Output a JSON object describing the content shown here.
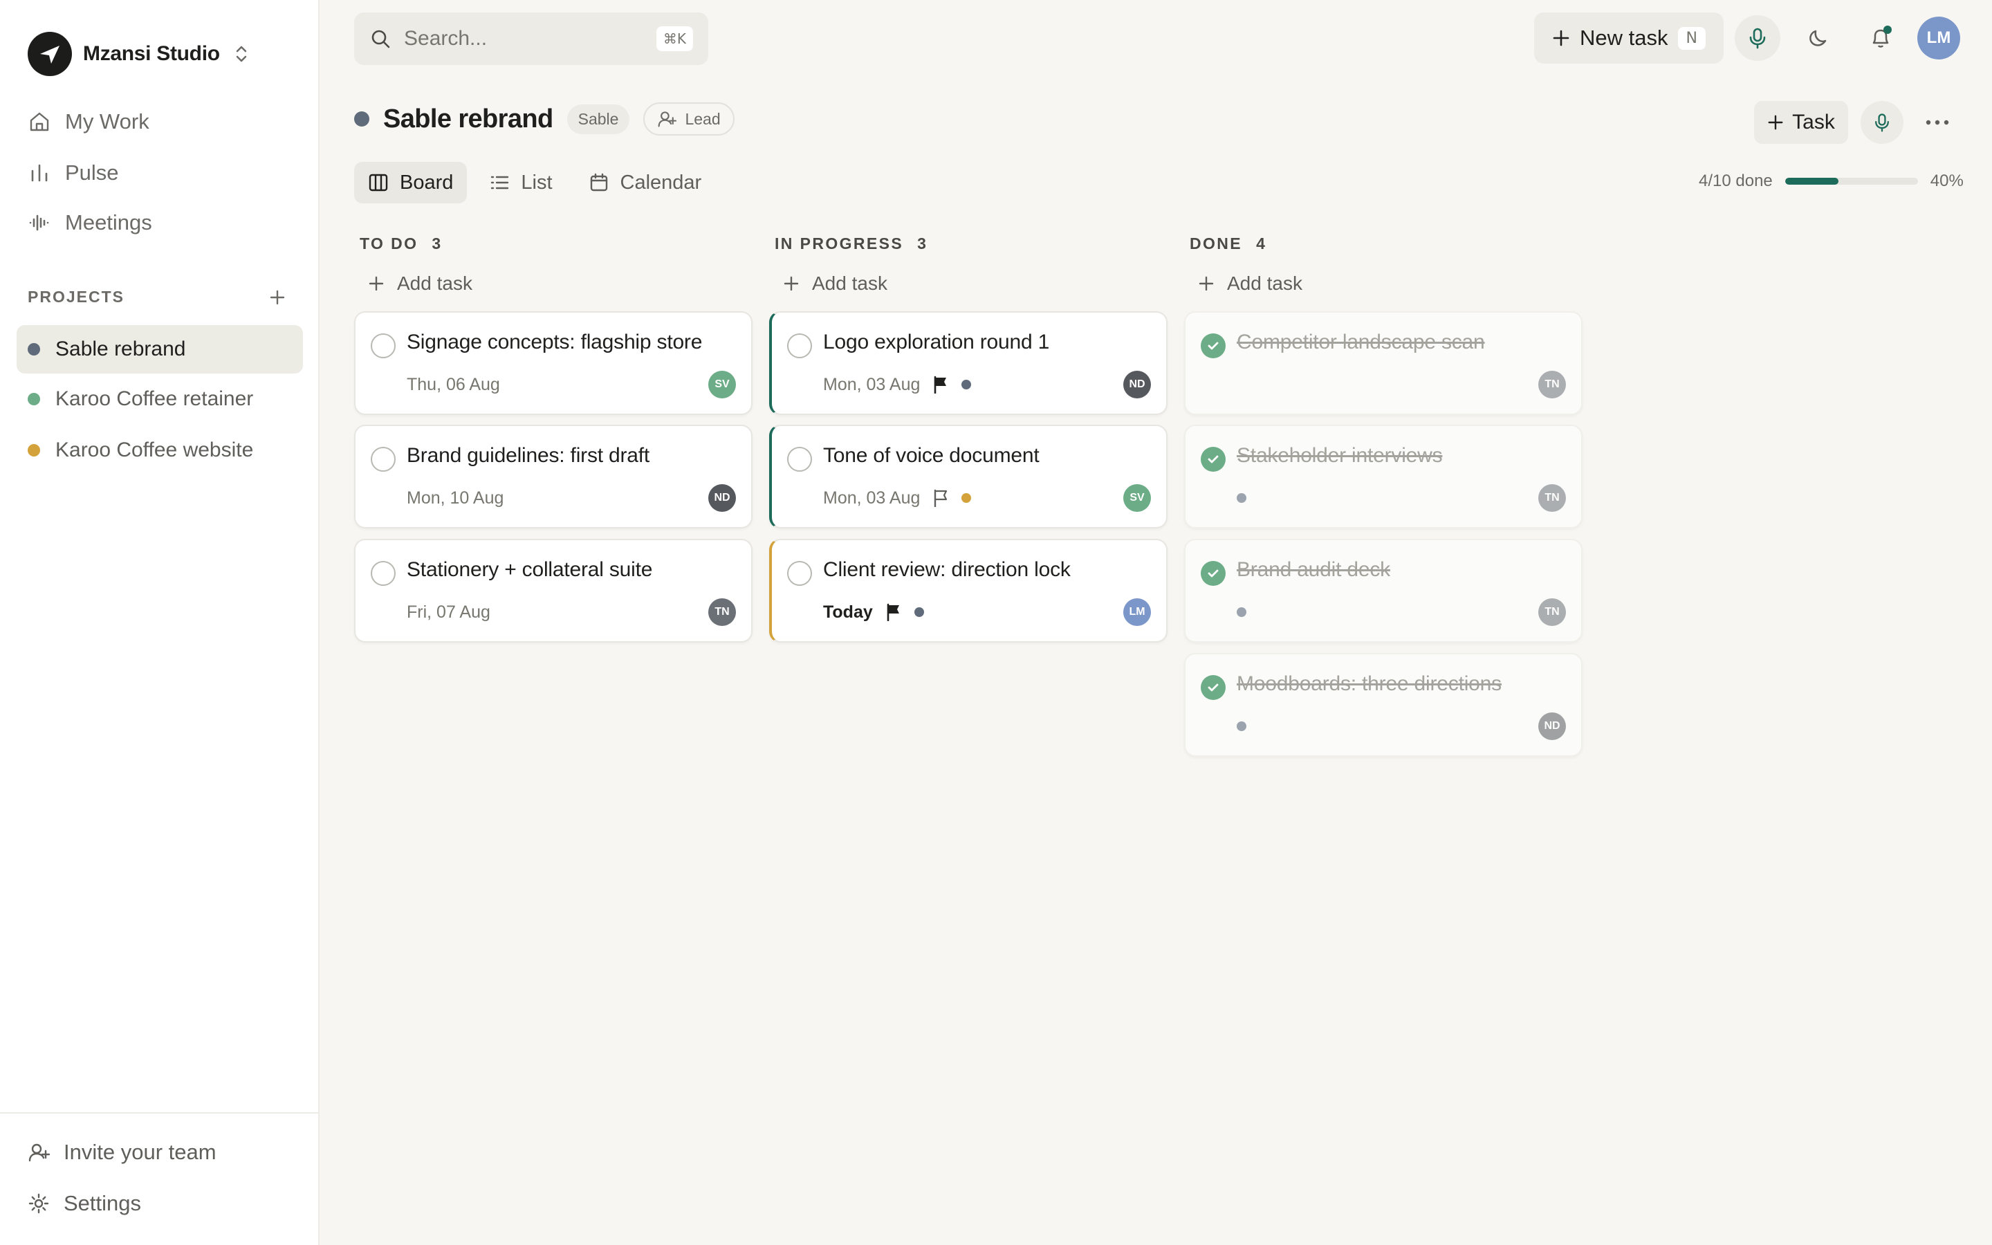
{
  "workspace": {
    "name": "Mzansi Studio"
  },
  "nav": {
    "my_work": "My Work",
    "pulse": "Pulse",
    "meetings": "Meetings"
  },
  "projects": {
    "title": "PROJECTS",
    "items": [
      {
        "label": "Sable rebrand",
        "color": "#5f6b7a",
        "active": true
      },
      {
        "label": "Karoo Coffee retainer",
        "color": "#6cad87",
        "active": false
      },
      {
        "label": "Karoo Coffee website",
        "color": "#d3a23a",
        "active": false
      }
    ]
  },
  "sidebar_bottom": {
    "invite": "Invite your team",
    "settings": "Settings"
  },
  "search": {
    "placeholder": "Search...",
    "shortcut": "⌘K"
  },
  "topbar": {
    "new_task": "New task",
    "new_task_shortcut": "N",
    "user_initials": "LM"
  },
  "project": {
    "title": "Sable rebrand",
    "tag": "Sable",
    "lead": "Lead",
    "task_button": "Task",
    "views": [
      "Board",
      "List",
      "Calendar"
    ],
    "active_view": "Board",
    "progress_label": "4/10 done",
    "progress_percent": "40%",
    "progress_value": 0.4
  },
  "board": {
    "add_task": "Add task",
    "columns": [
      {
        "title": "TO DO",
        "count": "3",
        "cards": [
          {
            "title": "Signage concepts: flagship store",
            "date": "Thu, 06 Aug",
            "assignee": "SV"
          },
          {
            "title": "Brand guidelines: first draft",
            "date": "Mon, 10 Aug",
            "assignee": "ND"
          },
          {
            "title": "Stationery + collateral suite",
            "date": "Fri, 07 Aug",
            "assignee": "TN"
          }
        ]
      },
      {
        "title": "IN PROGRESS",
        "count": "3",
        "cards": [
          {
            "title": "Logo exploration round 1",
            "date": "Mon, 03 Aug",
            "assignee": "ND",
            "flag": "filled"
          },
          {
            "title": "Tone of voice document",
            "date": "Mon, 03 Aug",
            "assignee": "SV",
            "flag": "outline"
          },
          {
            "title": "Client review: direction lock",
            "date": "Today",
            "assignee": "LM",
            "flag": "filled"
          }
        ]
      },
      {
        "title": "DONE",
        "count": "4",
        "cards": [
          {
            "title": "Competitor landscape scan",
            "assignee": "TN"
          },
          {
            "title": "Stakeholder interviews",
            "assignee": "TN"
          },
          {
            "title": "Brand audit deck",
            "assignee": "TN"
          },
          {
            "title": "Moodboards: three directions",
            "assignee": "ND"
          }
        ]
      }
    ]
  },
  "colors": {
    "accent": "#1d6b5a",
    "avatar_sv": "#6cad87",
    "avatar_nd": "#55595e",
    "avatar_tn": "#6b7077",
    "avatar_lm": "#7b97c9",
    "amber": "#d3a23a",
    "slate": "#5f6b7a"
  }
}
